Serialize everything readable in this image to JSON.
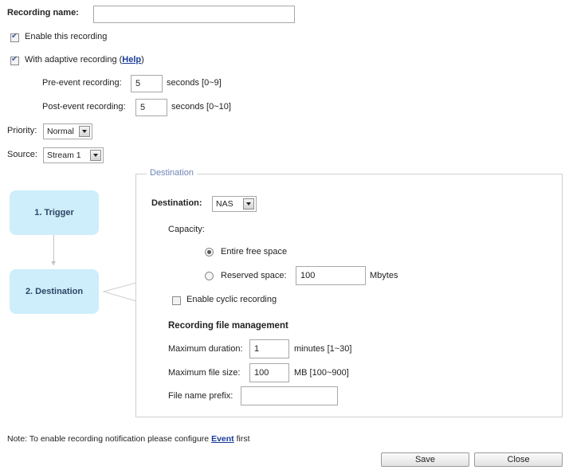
{
  "recording": {
    "name_label": "Recording name:",
    "name_value": "",
    "enable_label": "Enable this recording",
    "enable_checked": true,
    "adaptive_label": "With adaptive recording (",
    "adaptive_help": "Help",
    "adaptive_close": ")",
    "adaptive_checked": true,
    "pre_event_label": "Pre-event recording:",
    "pre_event_value": "5",
    "pre_event_unit": "seconds [0~9]",
    "post_event_label": "Post-event recording:",
    "post_event_value": "5",
    "post_event_unit": "seconds [0~10]",
    "priority_label": "Priority:",
    "priority_value": "Normal",
    "source_label": "Source:",
    "source_value": "Stream 1"
  },
  "steps": {
    "trigger": "1. Trigger",
    "destination": "2. Destination"
  },
  "destination": {
    "legend": "Destination",
    "label": "Destination:",
    "value": "NAS",
    "capacity_label": "Capacity:",
    "entire_label": "Entire free space",
    "entire_selected": true,
    "reserved_label": "Reserved space:",
    "reserved_value": "100",
    "reserved_unit": "Mbytes",
    "cyclic_label": "Enable cyclic recording",
    "cyclic_checked": false,
    "file_mgmt_title": "Recording file management",
    "max_duration_label": "Maximum duration:",
    "max_duration_value": "1",
    "max_duration_unit": "minutes [1~30]",
    "max_size_label": "Maximum file size:",
    "max_size_value": "100",
    "max_size_unit": "MB [100~900]",
    "prefix_label": "File name prefix:",
    "prefix_value": ""
  },
  "footer": {
    "note_prefix": "Note: To enable recording notification please configure ",
    "note_link": "Event",
    "note_suffix": " first",
    "save_label": "Save",
    "close_label": "Close"
  }
}
